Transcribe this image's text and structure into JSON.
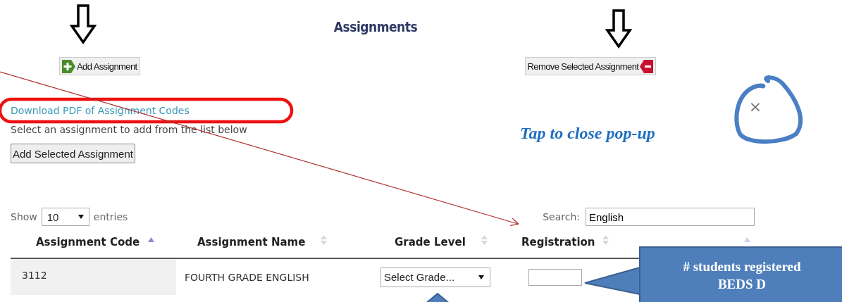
{
  "title": "Assignments",
  "toolbar": [
    {
      "label": "Add Assignment",
      "kind": "add"
    },
    {
      "label": "Remove Selected Assignment",
      "kind": "remove"
    }
  ],
  "link": "Download PDF of Assignment Codes",
  "instructions": "Select an assignment to add from the list below",
  "close_button": "×",
  "add_selected_button": "Add Selected Assignment",
  "length_menu": {
    "prefix": "Show",
    "value": "10",
    "suffix": "entries"
  },
  "search": {
    "label": "Search:",
    "value": "English"
  },
  "table": {
    "columns": [
      {
        "label": "Assignment Code",
        "sorted": true
      },
      {
        "label": "Assignment Name",
        "sorted": false
      },
      {
        "label": "Grade Level",
        "sorted": false
      },
      {
        "label": "Registration",
        "sorted": false
      },
      {
        "sorted": true
      }
    ],
    "rows": [
      {
        "code": "3112",
        "name": "FOURTH GRADE ENGLISH",
        "grade": "Select Grade..."
      }
    ]
  },
  "annotations": {
    "close_hint": "Tap to close pop-up",
    "callout": [
      "# students registered",
      "BEDS D"
    ]
  }
}
